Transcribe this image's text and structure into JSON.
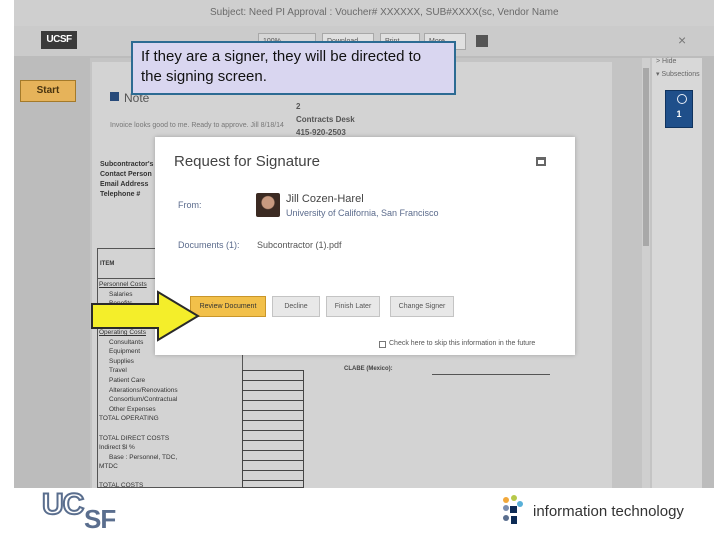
{
  "window": {
    "subject": "Subject: Need PI Approval : Voucher# XXXXXX, SUB#XXXX(sc, Vendor Name",
    "logo_text": "UCSF",
    "toolbar": {
      "zoom": "100%",
      "download": "Download",
      "print": "Print",
      "more": "More"
    },
    "close_glyph": "×"
  },
  "left": {
    "start_label": "Start"
  },
  "document": {
    "note_title": "Note",
    "note_small": "Invoice looks good to me. Ready to approve. Jill 8/18/14",
    "contracts_lines": [
      "2",
      "Contracts Desk",
      "415-920-2503"
    ],
    "sub_labels": [
      "Subcontractor's",
      "Contact Person",
      "Email Address",
      "Telephone #"
    ],
    "table_header": "ITEM",
    "budget_lines": [
      {
        "text": "Personnel Costs",
        "style": "u"
      },
      {
        "text": "Salaries",
        "style": "ind"
      },
      {
        "text": "Benefits",
        "style": "ind"
      },
      {
        "text": "",
        "style": ""
      },
      {
        "text": "",
        "style": ""
      },
      {
        "text": "Operating Costs",
        "style": "u"
      },
      {
        "text": "Consultants",
        "style": "ind"
      },
      {
        "text": "Equipment",
        "style": "ind"
      },
      {
        "text": "Supplies",
        "style": "ind"
      },
      {
        "text": "Travel",
        "style": "ind"
      },
      {
        "text": "Patient Care",
        "style": "ind"
      },
      {
        "text": "Alterations/Renovations",
        "style": "ind"
      },
      {
        "text": "Consortium/Contractual",
        "style": "ind"
      },
      {
        "text": "Other Expenses",
        "style": "ind"
      },
      {
        "text": "TOTAL OPERATING",
        "style": ""
      },
      {
        "text": "",
        "style": ""
      },
      {
        "text": "TOTAL DIRECT COSTS",
        "style": ""
      },
      {
        "text": "Indirect $l     %",
        "style": ""
      },
      {
        "text": "Base : Personnel, TDC,",
        "style": "ind"
      },
      {
        "text": "MTDC",
        "style": ""
      },
      {
        "text": "",
        "style": ""
      },
      {
        "text": "TOTAL COSTS",
        "style": ""
      }
    ],
    "clabe": "CLABE (Mexico):"
  },
  "right_panel": {
    "hide": "> Hide",
    "subsection": "▾ Subsections",
    "page_number": "1"
  },
  "modal": {
    "title": "Request for Signature",
    "from_label": "From:",
    "sender_name": "Jill Cozen-Harel",
    "sender_org": "University of California, San Francisco",
    "documents_label": "Documents (1):",
    "documents_value": "Subcontractor (1).pdf",
    "buttons": {
      "review": "Review Document",
      "decline": "Decline",
      "finish_later": "Finish Later",
      "change_signer": "Change Signer"
    },
    "skip_text": "Check here to skip this information in the future"
  },
  "callout": {
    "text": "If they are a signer, they will be directed to the signing screen."
  },
  "footer": {
    "ucsf_logo": "UCSF",
    "it_text": "information technology"
  },
  "colors": {
    "accent_yellow": "#f2c04a",
    "arrow_fill": "#f4ee2a",
    "callout_bg": "#d9d6f0",
    "callout_border": "#2c6b93",
    "ucsf_blue": "#052049"
  }
}
